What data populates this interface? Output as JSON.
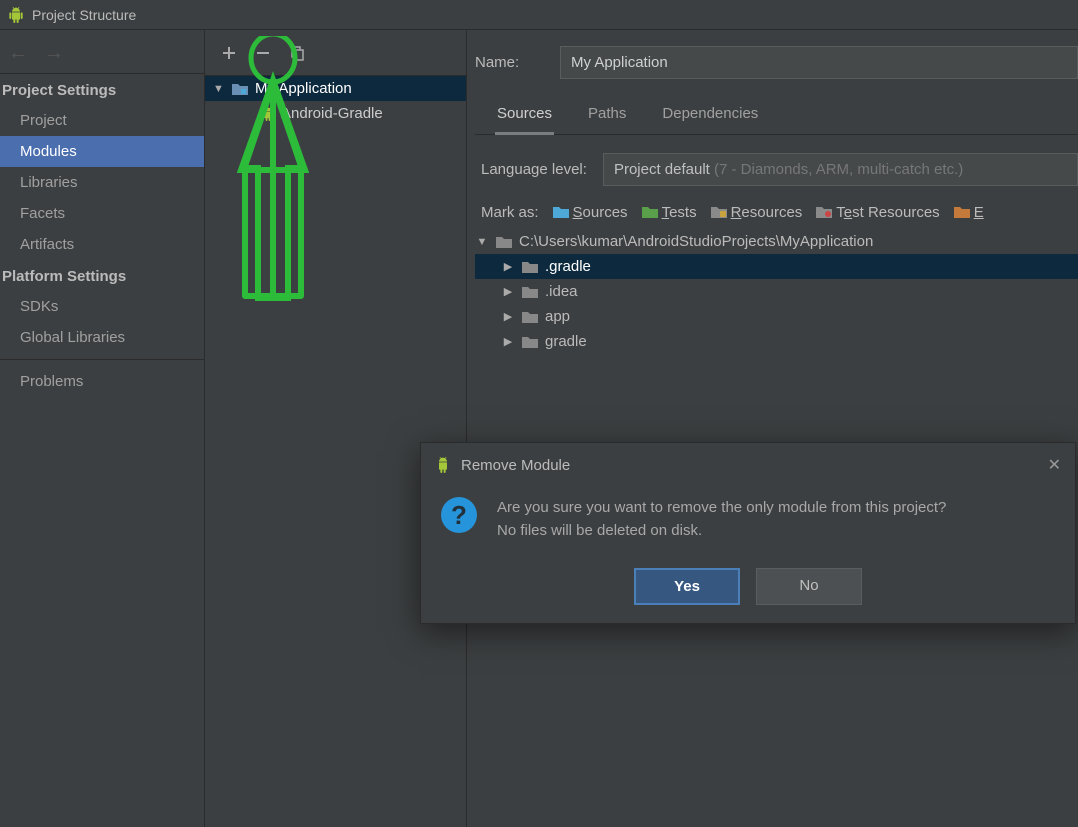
{
  "window": {
    "title": "Project Structure"
  },
  "sidebar": {
    "section1": "Project Settings",
    "items1": [
      "Project",
      "Modules",
      "Libraries",
      "Facets",
      "Artifacts"
    ],
    "section2": "Platform Settings",
    "items2": [
      "SDKs",
      "Global Libraries"
    ],
    "problems": "Problems"
  },
  "tree": {
    "root": "My Application",
    "child": "Android-Gradle"
  },
  "form": {
    "name_label": "Name:",
    "name_value": "My Application",
    "tabs": [
      "Sources",
      "Paths",
      "Dependencies"
    ],
    "lang_label": "Language level:",
    "lang_value": "Project default",
    "lang_hint": "(7 - Diamonds, ARM, multi-catch etc.)",
    "markas_label": "Mark as:",
    "mark_sources": "Sources",
    "mark_tests": "Tests",
    "mark_resources": "Resources",
    "mark_testres": "Test Resources",
    "mark_excluded": "E"
  },
  "dirs": {
    "root": "C:\\Users\\kumar\\AndroidStudioProjects\\MyApplication",
    "children": [
      ".gradle",
      ".idea",
      "app",
      "gradle"
    ]
  },
  "dialog": {
    "title": "Remove Module",
    "line1": "Are you sure you want to remove the only module from this project?",
    "line2": "No files will be deleted on disk.",
    "yes": "Yes",
    "no": "No"
  }
}
